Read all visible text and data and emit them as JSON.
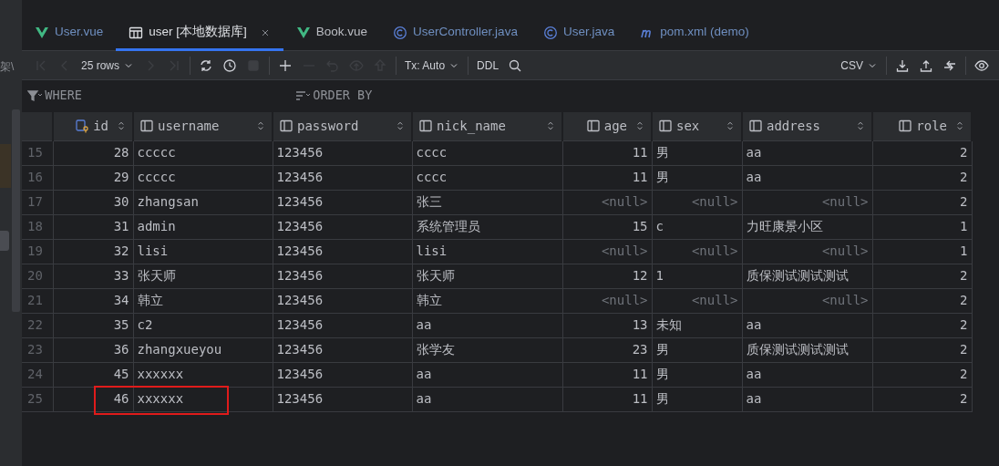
{
  "side_text": "架\\",
  "tabs": [
    {
      "label": "User.vue",
      "kind": "vue",
      "color": "#6f8fc0",
      "selected": false,
      "closable": false
    },
    {
      "label": "user [本地数据库]",
      "kind": "table",
      "color": "#dfe1e5",
      "selected": true,
      "closable": true
    },
    {
      "label": "Book.vue",
      "kind": "vue",
      "color": "#bcbec4",
      "selected": false,
      "closable": false
    },
    {
      "label": "UserController.java",
      "kind": "class",
      "color": "#6f8fc0",
      "selected": false,
      "closable": false
    },
    {
      "label": "User.java",
      "kind": "class",
      "color": "#6f8fc0",
      "selected": false,
      "closable": false
    },
    {
      "label": "pom.xml (demo)",
      "kind": "maven",
      "color": "#6f8fc0",
      "selected": false,
      "closable": false
    }
  ],
  "toolbar": [
    {
      "kind": "first",
      "disabled": true
    },
    {
      "kind": "prev",
      "disabled": true
    },
    {
      "kind": "dropdown",
      "label": "25 rows",
      "disabled": false
    },
    {
      "kind": "next",
      "disabled": true
    },
    {
      "kind": "last",
      "disabled": true
    },
    {
      "kind": "separator"
    },
    {
      "kind": "refresh",
      "disabled": false
    },
    {
      "kind": "history",
      "disabled": false
    },
    {
      "kind": "stop",
      "disabled": true
    },
    {
      "kind": "separator"
    },
    {
      "kind": "add",
      "disabled": false
    },
    {
      "kind": "remove",
      "disabled": true
    },
    {
      "kind": "revert",
      "disabled": true
    },
    {
      "kind": "preview",
      "disabled": true
    },
    {
      "kind": "submit",
      "disabled": true
    },
    {
      "kind": "separator"
    },
    {
      "kind": "dropdown",
      "label": "Tx: Auto",
      "disabled": false
    },
    {
      "kind": "separator"
    },
    {
      "kind": "text",
      "label": "DDL",
      "disabled": false
    },
    {
      "kind": "search",
      "disabled": false
    },
    {
      "kind": "spacer"
    },
    {
      "kind": "dropdown",
      "label": "CSV",
      "disabled": false
    },
    {
      "kind": "separator"
    },
    {
      "kind": "download",
      "disabled": false
    },
    {
      "kind": "upload",
      "disabled": false
    },
    {
      "kind": "compare",
      "disabled": false
    },
    {
      "kind": "separator"
    },
    {
      "kind": "view",
      "disabled": false
    }
  ],
  "filters": {
    "where": "WHERE",
    "order_by": "ORDER BY"
  },
  "table": {
    "columns": [
      {
        "name": "id",
        "kind": "key"
      },
      {
        "name": "username",
        "kind": "text"
      },
      {
        "name": "password",
        "kind": "text"
      },
      {
        "name": "nick_name",
        "kind": "text"
      },
      {
        "name": "age",
        "kind": "number"
      },
      {
        "name": "sex",
        "kind": "text"
      },
      {
        "name": "address",
        "kind": "text"
      },
      {
        "name": "role",
        "kind": "number"
      }
    ],
    "rows": [
      {
        "number": "15",
        "marked": false,
        "cells": [
          "28",
          "ccccc",
          "123456",
          "cccc",
          "11",
          "男",
          "aa",
          "2"
        ]
      },
      {
        "number": "16",
        "marked": false,
        "cells": [
          "29",
          "ccccc",
          "123456",
          "cccc",
          "11",
          "男",
          "aa",
          "2"
        ]
      },
      {
        "number": "17",
        "marked": false,
        "cells": [
          "30",
          "zhangsan",
          "123456",
          "张三",
          {
            "text": "<null>",
            "kind": "null"
          },
          {
            "text": "<null>",
            "kind": "null"
          },
          {
            "text": "<null>",
            "kind": "null"
          },
          "2"
        ]
      },
      {
        "number": "18",
        "marked": false,
        "cells": [
          "31",
          "admin",
          "123456",
          "系统管理员",
          "15",
          "c",
          "力旺康景小区",
          "1"
        ]
      },
      {
        "number": "19",
        "marked": false,
        "cells": [
          "32",
          "lisi",
          "123456",
          "lisi",
          {
            "text": "<null>",
            "kind": "null"
          },
          {
            "text": "<null>",
            "kind": "null"
          },
          {
            "text": "<null>",
            "kind": "null"
          },
          "1"
        ]
      },
      {
        "number": "20",
        "marked": false,
        "cells": [
          "33",
          "张天师",
          "123456",
          "张天师",
          "12",
          "1",
          "质保测试测试测试",
          "2"
        ]
      },
      {
        "number": "21",
        "marked": false,
        "cells": [
          "34",
          "韩立",
          "123456",
          "韩立",
          {
            "text": "<null>",
            "kind": "null"
          },
          {
            "text": "<null>",
            "kind": "null"
          },
          {
            "text": "<null>",
            "kind": "null"
          },
          "2"
        ]
      },
      {
        "number": "22",
        "marked": false,
        "cells": [
          "35",
          "c2",
          "123456",
          "aa",
          "13",
          "未知",
          "aa",
          "2"
        ]
      },
      {
        "number": "23",
        "marked": false,
        "cells": [
          "36",
          "zhangxueyou",
          "123456",
          "张学友",
          "23",
          "男",
          "质保测试测试测试",
          "2"
        ]
      },
      {
        "number": "24",
        "marked": false,
        "cells": [
          "45",
          "xxxxxx",
          "123456",
          "aa",
          "11",
          "男",
          "aa",
          "2"
        ]
      },
      {
        "number": "25",
        "marked": true,
        "cells": [
          "46",
          "xxxxxx",
          "123456",
          "aa",
          "11",
          "男",
          "aa",
          "2"
        ]
      }
    ]
  }
}
